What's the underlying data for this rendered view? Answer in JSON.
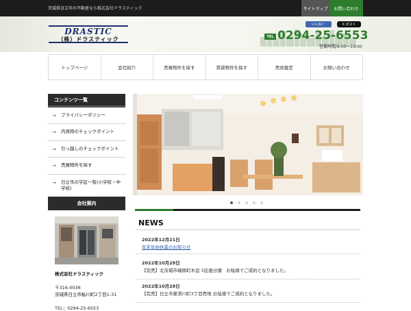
{
  "topbar": {
    "tagline": "茨城県日立市の不動産なら株式会社ドラスティック",
    "sitemap_label": "サイトマップ",
    "contact_label": "お問い合わせ"
  },
  "header": {
    "logo_text_en": "DRASTIC",
    "logo_text_jp": "（株）ドラスティック",
    "facebook_label": "いいね！",
    "x_post_label": "X ポスト",
    "tel_badge": "TEL",
    "tel_number": "0294-25-6553",
    "hours": "営業時間/9:00〜19:00"
  },
  "nav": {
    "items": [
      {
        "label": "トップページ"
      },
      {
        "label": "会社紹介"
      },
      {
        "label": "売買物件を探す"
      },
      {
        "label": "賃貸物件を探す"
      },
      {
        "label": "売却査定"
      },
      {
        "label": "お問い合わせ"
      }
    ]
  },
  "sidebar": {
    "heading": "コンテンツ一覧",
    "items": [
      {
        "label": "プライバシーポリシー"
      },
      {
        "label": "内見時のチェックポイント"
      },
      {
        "label": "引っ越しのチェックポイント"
      },
      {
        "label": "売買物件を探す"
      },
      {
        "label": "日立市の学区一覧(小学校・中学校)"
      }
    ],
    "company_heading": "会社案内",
    "company_name": "株式会社ドラスティック",
    "company_zip": "〒316-0036",
    "company_address": "茨城県日立市鮎川町2丁目1-31",
    "company_tel": "TEL：0294-25-6553"
  },
  "slider": {
    "slide_count": 5,
    "active_index": 0,
    "progress": 0.17
  },
  "news": {
    "heading": "NEWS",
    "items": [
      {
        "date": "2022年12月21日",
        "text": "年末年始休業のお知らせ",
        "link": true
      },
      {
        "date": "2022年10月28日",
        "text": "【完売】北茨城市磯原町木皿 5区画分譲　お陰様でご成約となりました。",
        "link": false
      },
      {
        "date": "2022年10月28日",
        "text": "【完売】日立市東滑川町3丁目売地 お陰様でご成約となりました。",
        "link": false
      }
    ]
  },
  "colors": {
    "accent_green": "#2e7d2e",
    "dark": "#1c1c1c",
    "link_blue": "#2b5fa8"
  }
}
